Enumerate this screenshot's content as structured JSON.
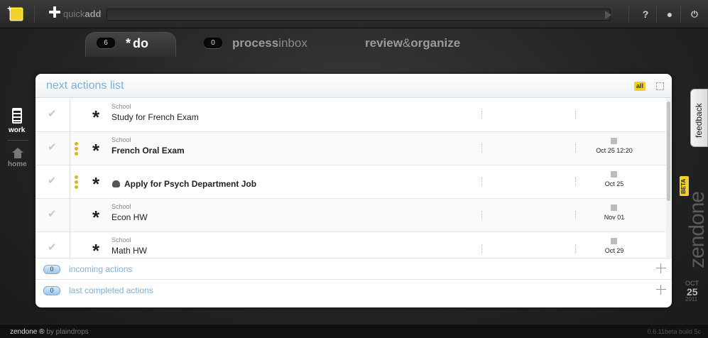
{
  "topbar": {
    "quickadd_prefix": "quick",
    "quickadd_bold": "add",
    "help_icon": "help-icon",
    "user_icon": "user-icon",
    "power_icon": "power-icon"
  },
  "tabs": [
    {
      "count": "6",
      "label": "do",
      "star": "*"
    },
    {
      "count": "0",
      "label_bold": "process",
      "label_light": "inbox"
    },
    {
      "label_a": "review",
      "label_amp": "&",
      "label_b": "organize"
    }
  ],
  "sidebar": {
    "items": [
      {
        "label": "work",
        "icon": "work-icon"
      },
      {
        "label": "home",
        "icon": "home-icon"
      }
    ]
  },
  "panel": {
    "title": "next actions list",
    "filter_label": "all"
  },
  "actions": [
    {
      "context": "School",
      "title": "Study for French Exam",
      "bold": false,
      "priority": false,
      "due": ""
    },
    {
      "context": "School",
      "title": "French Oral Exam",
      "bold": true,
      "priority": true,
      "due": "Oct 25 12:20"
    },
    {
      "context": "",
      "title": "Apply for Psych Department Job",
      "bold": true,
      "priority": true,
      "due": "Oct 25"
    },
    {
      "context": "School",
      "title": "Econ HW",
      "bold": false,
      "priority": false,
      "due": "Nov 01"
    },
    {
      "context": "School",
      "title": "Math HW",
      "bold": false,
      "priority": false,
      "due": "Oct 29"
    }
  ],
  "sections": [
    {
      "count": "0",
      "label": "incoming actions"
    },
    {
      "count": "0",
      "label": "last completed actions"
    }
  ],
  "right": {
    "feedback": "feedback",
    "brand": "zendone",
    "beta": "BETA",
    "month": "OCT",
    "day": "25",
    "year": "2011"
  },
  "footer": {
    "app": "zendone",
    "mark": "®",
    "by": "by",
    "author": "plaindrops",
    "version": "0.6.11beta build 5c"
  },
  "colors": {
    "accent_yellow": "#f2d22a",
    "link_blue": "#7fb0d6"
  }
}
